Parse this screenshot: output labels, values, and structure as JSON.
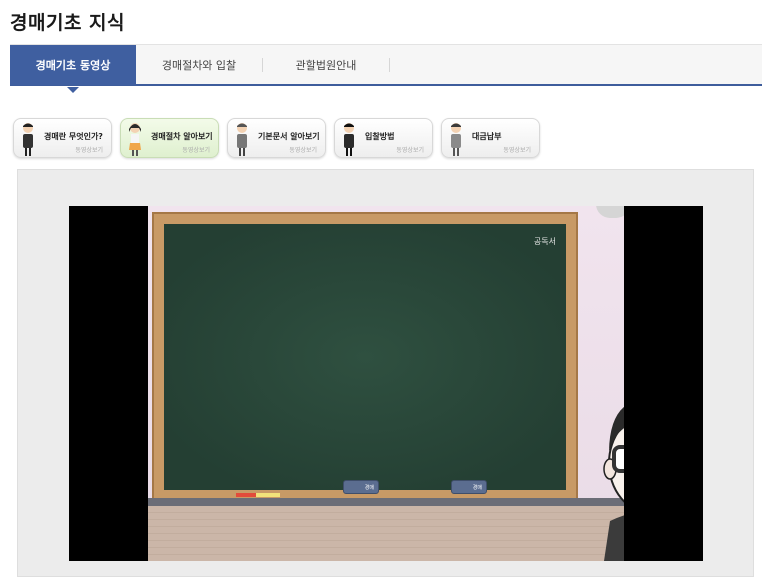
{
  "page": {
    "title": "경매기초 지식"
  },
  "tabs": [
    {
      "label": "경매기초 동영상",
      "active": true
    },
    {
      "label": "경매절차와 입찰",
      "active": false
    },
    {
      "label": "관할법원안내",
      "active": false
    }
  ],
  "video_buttons": [
    {
      "label": "경매란 무엇인가?",
      "sub": "동영상보기",
      "selected": false,
      "icon": "businessman-icon"
    },
    {
      "label": "경매절차 알아보기",
      "sub": "동영상보기",
      "selected": true,
      "icon": "woman-character-icon"
    },
    {
      "label": "기본문서 알아보기",
      "sub": "동영상보기",
      "selected": false,
      "icon": "businessman-icon"
    },
    {
      "label": "입찰방법",
      "sub": "동영상보기",
      "selected": false,
      "icon": "businessman-icon"
    },
    {
      "label": "대금납부",
      "sub": "동영상보기",
      "selected": false,
      "icon": "businessman-icon"
    }
  ],
  "video": {
    "board_mark": "공독서",
    "eraser_label_1": "경매",
    "eraser_label_2": "경매",
    "character": "cartoon-teacher-with-glasses"
  },
  "colors": {
    "tab_active": "#3f5fa0",
    "board": "#2f5040",
    "board_frame": "#c89a66",
    "selected_button": "#dff0cf"
  }
}
